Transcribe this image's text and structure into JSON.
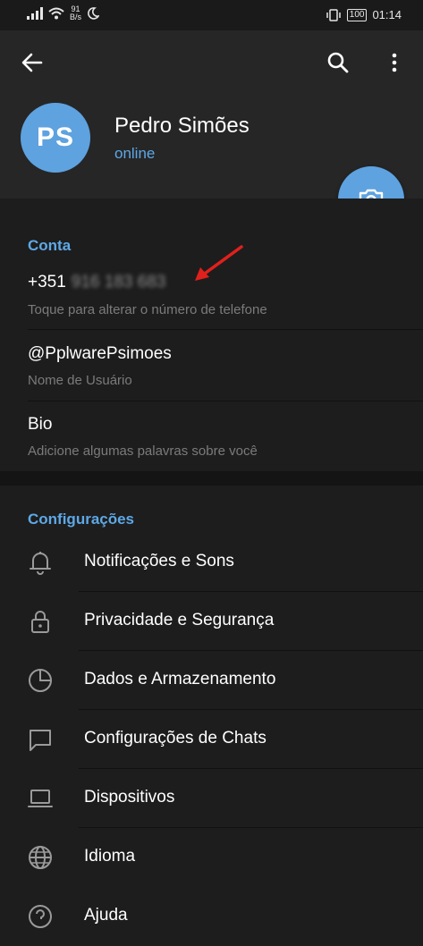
{
  "status_bar": {
    "net_speed_value": "91",
    "net_speed_unit": "B/s",
    "battery": "100",
    "time": "01:14"
  },
  "profile": {
    "initials": "PS",
    "name": "Pedro Simões",
    "status": "online"
  },
  "account": {
    "title": "Conta",
    "phone_prefix": "+351",
    "phone_hidden": "916 183 683",
    "phone_hint": "Toque para alterar o número de telefone",
    "username": "@PplwarePsimoes",
    "username_hint": "Nome de Usuário",
    "bio": "Bio",
    "bio_hint": "Adicione algumas palavras sobre você"
  },
  "settings": {
    "title": "Configurações",
    "items": [
      {
        "label": "Notificações e Sons",
        "icon": "bell-icon"
      },
      {
        "label": "Privacidade e Segurança",
        "icon": "lock-icon"
      },
      {
        "label": "Dados e Armazenamento",
        "icon": "pie-chart-icon"
      },
      {
        "label": "Configurações de Chats",
        "icon": "chat-bubble-icon"
      },
      {
        "label": "Dispositivos",
        "icon": "laptop-icon"
      },
      {
        "label": "Idioma",
        "icon": "globe-icon"
      },
      {
        "label": "Ajuda",
        "icon": "help-icon"
      }
    ]
  },
  "colors": {
    "accent": "#5ea2e0",
    "background": "#1d1d1d",
    "header": "#262626",
    "annotation_arrow": "#e0201c"
  }
}
